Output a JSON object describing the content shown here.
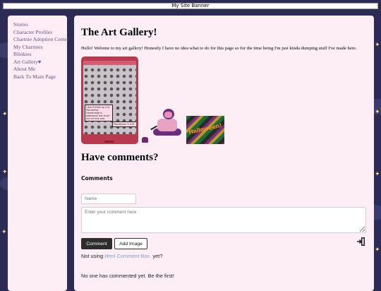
{
  "banner": {
    "alt_text": "My Site Banner"
  },
  "sidebar": {
    "links": [
      {
        "label": "Stories"
      },
      {
        "label": "Character Profiles"
      },
      {
        "label": "Charmie Adoption Center"
      },
      {
        "label": "My Charmies"
      },
      {
        "label": "Blinkies"
      },
      {
        "label": "Art Gallery♥"
      },
      {
        "label": "About Me"
      },
      {
        "label": "Back To Main Page"
      }
    ]
  },
  "main": {
    "title": "The Art Gallery!",
    "intro": "Hello! Welome to my art gallery! Honestly I have no idea what to do for this page so for the time being I'm just kinda dumping stuff I've made here.",
    "gallery": {
      "phone_note_1": "I don't think so LOL Ponderisa. Handmade is awesome but trust me on this one.",
      "phone_note_2": "Ponderisa: 9 A.M.",
      "halloween_text": "Halloween!"
    },
    "comments_heading": "Have comments?"
  },
  "comment_box": {
    "title": "Comments",
    "name_placeholder": "Name",
    "comment_placeholder": "Enter your comment here",
    "comment_button": "Comment",
    "add_image_button": "Add Image",
    "not_using_prefix": "Not using ",
    "not_using_link": "Html Comment Box",
    "not_using_suffix": "  yet?",
    "empty_message": "No one has commented yet. Be the first!"
  },
  "colors": {
    "page_bg": "#2b2b55",
    "panel_bg": "#fdeef5",
    "nav_link": "#6b4c84",
    "link_blue": "#7f9dd8",
    "star": "#f6dc8a"
  }
}
